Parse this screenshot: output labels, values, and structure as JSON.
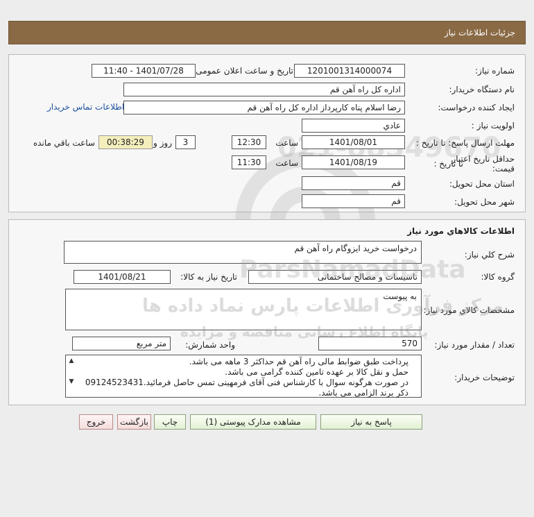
{
  "header": {
    "title": "جزئيات اطلاعات نیاز"
  },
  "info": {
    "need_number_label": "شماره نیاز:",
    "need_number": "1201001314000074",
    "announce_label": "تاریخ و ساعت اعلان عمومی:",
    "announce_value": "1401/07/28 - 11:40",
    "buyer_label": "نام دستگاه خریدار:",
    "buyer": "اداره کل  راه آهن قم",
    "creator_label": "ایجاد کننده درخواست:",
    "creator": "رضا اسلام پناه کارپرداز اداره کل  راه آهن قم",
    "contact_link": "اطلاعات تماس خریدار",
    "priority_label": "اولویت نیاز :",
    "priority": "عادي",
    "deadline_label": "مهلت ارسال پاسخ: تا تاریخ :",
    "deadline_date": "1401/08/01",
    "time_label": "ساعت",
    "deadline_time": "12:30",
    "days": "3",
    "days_label": "روز و",
    "remaining": "00:38:29",
    "remaining_label": "ساعت باقي مانده",
    "validity_label_1": "حداقل تاریخ اعتبار",
    "validity_label_2": "قیمت:",
    "validity_to_label": "تا تاریخ :",
    "validity_date": "1401/08/19",
    "validity_time": "11:30",
    "province_label": "استان محل تحویل:",
    "province": "قم",
    "city_label": "شهر محل تحویل:",
    "city": "قم"
  },
  "goods": {
    "title": "اطلاعات کالاهاي مورد نياز",
    "summary_label": "شرح کلي نياز:",
    "summary": "درخواست خرید ایزوگام راه آهن قم",
    "group_label": "گروه کالا:",
    "group": "تاسیسات و مصالح ساختمانی",
    "need_date_label": "تاریخ نیاز به کالا:",
    "need_date": "1401/08/21",
    "specs_label": "مشخصات کالاي مورد نياز:",
    "specs": "به پیوست",
    "qty_label": "تعداد / مقدار مورد نیاز:",
    "qty": "570",
    "unit_label": "واحد شمارش:",
    "unit": "متر مربع",
    "notes_label": "توضیحات خریدار:",
    "notes": [
      "پرداخت طبق ضوابط مالی راه آهن قم حداکثر 3 ماهه می باشد.",
      "حمل و نقل کالا بر عهده تامین کننده گرامی می باشد.",
      "در صورت هرگونه سوال با کارشناس فنی آقای فرمهینی تمس حاصل فرمائید.09124523431",
      "ذکر برند الزامی می باشد."
    ]
  },
  "buttons": {
    "reply": "پاسخ به نیاز",
    "attachments": "مشاهده مدارک پیوستی (1)",
    "print": "چاپ",
    "back": "بازگشت",
    "exit": "خروج"
  },
  "watermark": {
    "line1": "مرکز فرآوری اطلاعات پارس نماد داده ها",
    "line2": "پایگاه اطلاع رسانی مناقصه و مزایده",
    "brand": "ParsNamadData",
    "phone": "021-88349670"
  }
}
